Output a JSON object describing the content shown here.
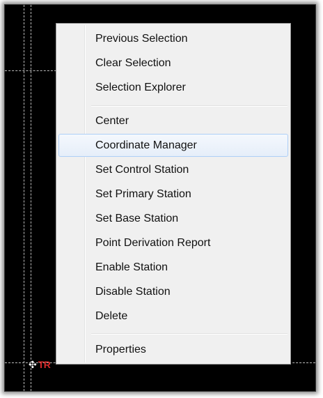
{
  "canvas": {
    "station_label": "TR",
    "station_marker_icon": "station-target-icon"
  },
  "menu": {
    "groups": [
      [
        "Previous Selection",
        "Clear Selection",
        "Selection Explorer"
      ],
      [
        "Center",
        "Coordinate Manager",
        "Set Control Station",
        "Set Primary Station",
        "Set Base Station",
        "Point Derivation Report",
        "Enable Station",
        "Disable Station",
        "Delete"
      ],
      [
        "Properties"
      ]
    ],
    "items": {
      "previous_selection": "Previous Selection",
      "clear_selection": "Clear Selection",
      "selection_explorer": "Selection Explorer",
      "center": "Center",
      "coordinate_manager": "Coordinate Manager",
      "set_control_station": "Set Control Station",
      "set_primary_station": "Set Primary Station",
      "set_base_station": "Set Base Station",
      "point_derivation_report": "Point Derivation Report",
      "enable_station": "Enable Station",
      "disable_station": "Disable Station",
      "delete": "Delete",
      "properties": "Properties"
    },
    "highlighted_item": "Coordinate Manager"
  }
}
